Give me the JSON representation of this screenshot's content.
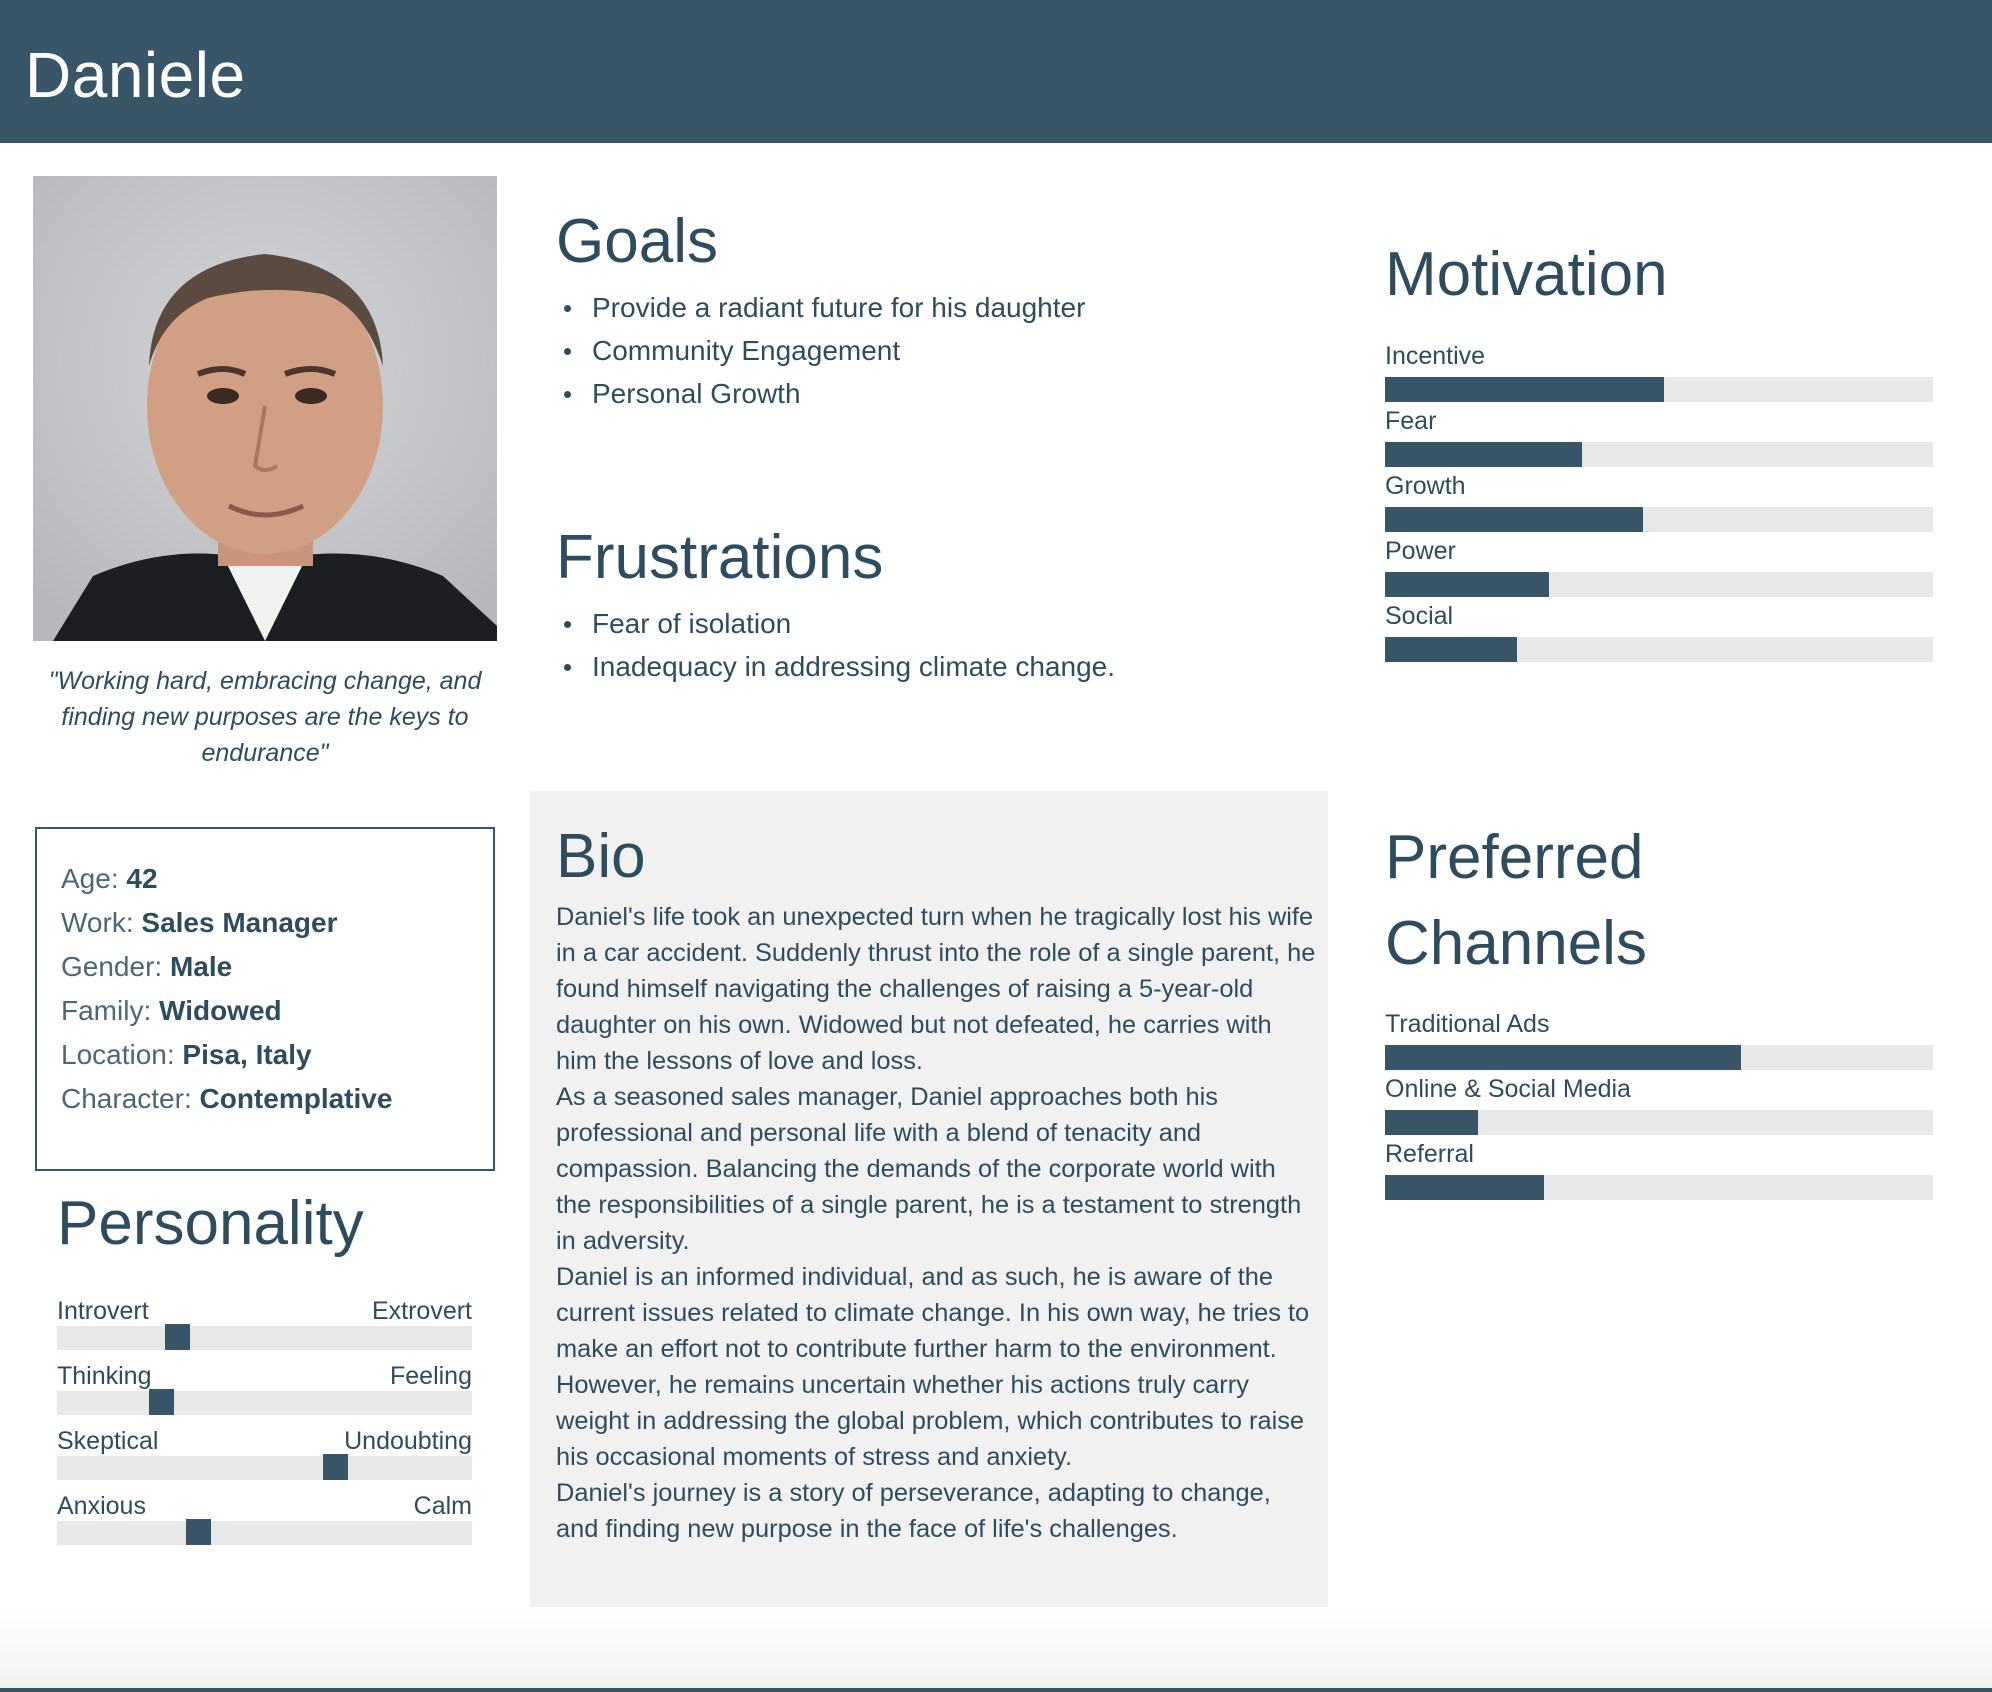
{
  "header": {
    "name": "Daniele"
  },
  "photo": {
    "label": "portrait"
  },
  "quote": "\"Working hard, embracing change, and finding new purposes are the keys to endurance\"",
  "info": [
    {
      "label": "Age:",
      "value": "42"
    },
    {
      "label": "Work:",
      "value": "Sales Manager"
    },
    {
      "label": "Gender:",
      "value": "Male"
    },
    {
      "label": "Family:",
      "value": "Widowed"
    },
    {
      "label": "Location:",
      "value": "Pisa, Italy"
    },
    {
      "label": "Character:",
      "value": "Contemplative"
    }
  ],
  "goals": {
    "title": "Goals",
    "items": [
      "Provide a radiant future for his daughter",
      "Community Engagement",
      "Personal Growth"
    ]
  },
  "frustrations": {
    "title": "Frustrations",
    "items": [
      "Fear of isolation",
      "Inadequacy in addressing climate change."
    ]
  },
  "motivation": {
    "title": "Motivation",
    "items": [
      {
        "label": "Incentive",
        "level": 0.51
      },
      {
        "label": "Fear",
        "level": 0.36
      },
      {
        "label": "Growth",
        "level": 0.47
      },
      {
        "label": "Power",
        "level": 0.3
      },
      {
        "label": "Social",
        "level": 0.24
      }
    ]
  },
  "bio": {
    "title": "Bio",
    "paragraphs": [
      "Daniel's life took an unexpected turn when he tragically lost his wife in a car accident. Suddenly thrust into the role of a single parent, he found himself navigating the challenges of raising a 5-year-old daughter on his own. Widowed but not defeated, he carries with him the lessons of love and loss.",
      "As a seasoned sales manager, Daniel approaches both his professional and personal life with a blend of tenacity and compassion. Balancing the demands of the corporate world with the responsibilities of a single parent, he is a testament to strength in adversity.",
      "Daniel is an informed individual, and as such, he is aware of the current issues related to climate change. In his own way, he tries to make an effort not to contribute further harm to the environment. However, he remains uncertain whether his actions truly carry weight in addressing the global problem, which contributes to raise his occasional moments of stress and anxiety.",
      "Daniel's journey is a story of perseverance, adapting to change, and finding new purpose in the face of life's challenges."
    ]
  },
  "channels": {
    "title_line1": "Preferred",
    "title_line2": "Channels",
    "items": [
      {
        "label": "Traditional Ads",
        "level": 0.65
      },
      {
        "label": "Online & Social Media",
        "level": 0.17
      },
      {
        "label": "Referral",
        "level": 0.29
      }
    ]
  },
  "personality": {
    "title": "Personality",
    "items": [
      {
        "left": "Introvert",
        "right": "Extrovert",
        "position": 0.29
      },
      {
        "left": "Thinking",
        "right": "Feeling",
        "position": 0.25
      },
      {
        "left": "Skeptical",
        "right": "Undoubting",
        "position": 0.67
      },
      {
        "left": "Anxious",
        "right": "Calm",
        "position": 0.34
      }
    ]
  },
  "colors": {
    "accent": "#385668",
    "track": "#e8e8e9",
    "panel": "#f1f1f1"
  }
}
